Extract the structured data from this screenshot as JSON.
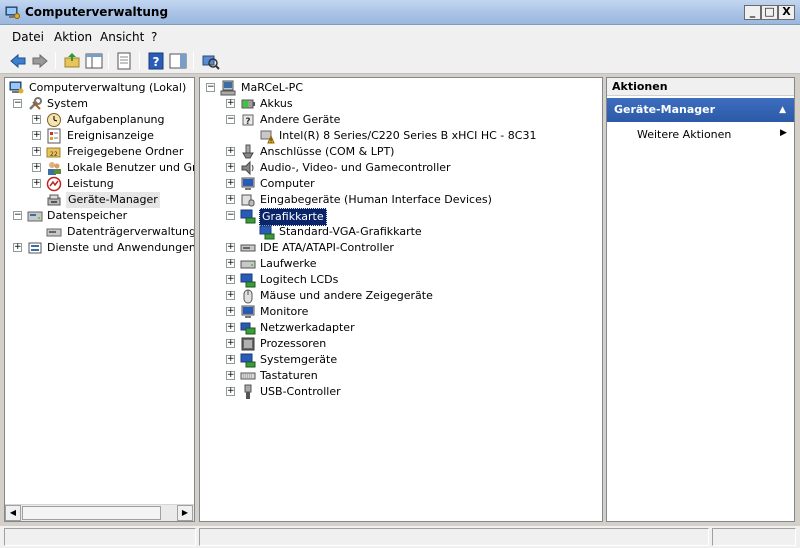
{
  "window": {
    "title": "Computerverwaltung",
    "minimize": "_",
    "maximize": "□",
    "close": "X"
  },
  "menu": {
    "items": [
      {
        "label": "Datei"
      },
      {
        "label": "Aktion"
      },
      {
        "label": "Ansicht"
      },
      {
        "label": "?"
      }
    ]
  },
  "left_tree": {
    "root": "Computerverwaltung (Lokal)",
    "system": "System",
    "aufgaben": "Aufgabenplanung",
    "ereignis": "Ereignisanzeige",
    "freigegeben": "Freigegebene Ordner",
    "benutzer": "Lokale Benutzer und Gruppen",
    "leistung": "Leistung",
    "geraete": "Geräte-Manager",
    "datenspeicher": "Datenspeicher",
    "datentraeger": "Datenträgerverwaltung",
    "dienste": "Dienste und Anwendungen"
  },
  "device_tree": {
    "computer": "MaRCeL-PC",
    "items": [
      {
        "label": "Akkus"
      },
      {
        "label": "Andere Geräte"
      },
      {
        "label": "Intel(R) 8 Series/C220 Series  B xHCI HC - 8C31"
      },
      {
        "label": "Anschlüsse (COM & LPT)"
      },
      {
        "label": "Audio-, Video- und Gamecontroller"
      },
      {
        "label": "Computer"
      },
      {
        "label": "Eingabegeräte (Human Interface Devices)"
      },
      {
        "label": "Grafikkarte"
      },
      {
        "label": "Standard-VGA-Grafikkarte"
      },
      {
        "label": "IDE ATA/ATAPI-Controller"
      },
      {
        "label": "Laufwerke"
      },
      {
        "label": "Logitech LCDs"
      },
      {
        "label": "Mäuse und andere Zeigegeräte"
      },
      {
        "label": "Monitore"
      },
      {
        "label": "Netzwerkadapter"
      },
      {
        "label": "Prozessoren"
      },
      {
        "label": "Systemgeräte"
      },
      {
        "label": "Tastaturen"
      },
      {
        "label": "USB-Controller"
      }
    ]
  },
  "actions": {
    "header": "Aktionen",
    "section": "Geräte-Manager",
    "more": "Weitere Aktionen"
  },
  "colors": {
    "selection": "#0a246a",
    "actions_header": "#2c5aa8"
  }
}
